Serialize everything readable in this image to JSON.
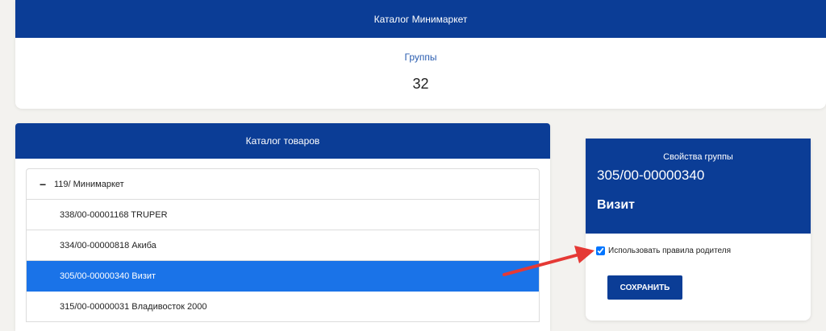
{
  "top_card": {
    "title": "Каталог Минимаркет",
    "groups_label": "Группы",
    "groups_count": "32"
  },
  "catalog": {
    "title": "Каталог товаров",
    "tree": {
      "root": {
        "toggle": "−",
        "label": "119/ Минимаркет"
      },
      "items": [
        {
          "label": "338/00-00001168 TRUPER",
          "selected": false
        },
        {
          "label": "334/00-00000818 Акиба",
          "selected": false
        },
        {
          "label": "305/00-00000340 Визит",
          "selected": true
        },
        {
          "label": "315/00-00000031 Владивосток 2000",
          "selected": false
        }
      ]
    }
  },
  "group_properties": {
    "title": "Свойства группы",
    "code": "305/00-00000340",
    "name": "Визит",
    "use_parent_rules": {
      "label": "Использовать правила родителя",
      "checked": true
    },
    "save_label": "СОХРАНИТЬ"
  },
  "colors": {
    "header_blue": "#0b3d96",
    "selected_blue": "#1a73e8",
    "annotation_arrow": "#e53935",
    "background": "#f3f2ef"
  }
}
